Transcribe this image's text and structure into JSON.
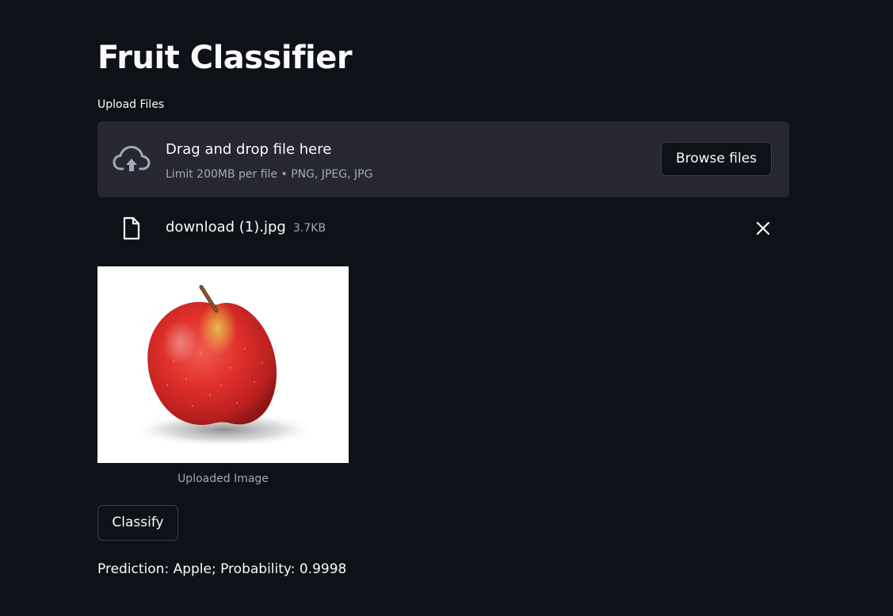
{
  "page": {
    "title": "Fruit Classifier",
    "background_color": "#0e1117"
  },
  "uploader": {
    "label": "Upload Files",
    "drop_text": "Drag and drop file here",
    "limit_text": "Limit 200MB per file • PNG, JPEG, JPG",
    "browse_label": "Browse files",
    "cloud_icon": "cloud-upload-icon",
    "dropzone_color": "#262730"
  },
  "uploaded_file": {
    "name": "download (1).jpg",
    "size": "3.7KB",
    "file_icon": "file-icon",
    "remove_icon": "close-icon"
  },
  "image": {
    "caption": "Uploaded Image"
  },
  "actions": {
    "classify_label": "Classify"
  },
  "result": {
    "text": "Prediction: Apple; Probability: 0.9998"
  }
}
